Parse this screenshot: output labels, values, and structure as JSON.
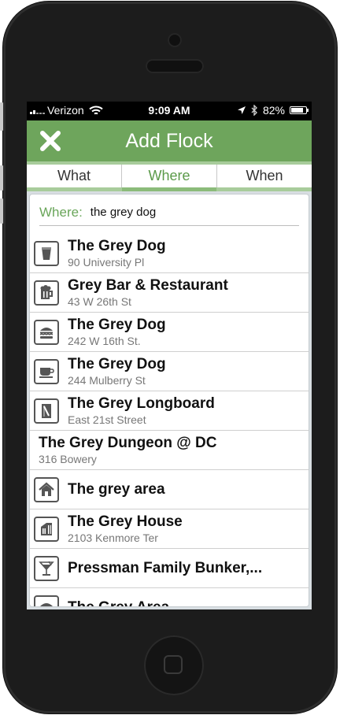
{
  "status_bar": {
    "carrier": "Verizon",
    "time": "9:09 AM",
    "battery": "82%"
  },
  "nav": {
    "title": "Add Flock",
    "close_icon": "close-x-icon"
  },
  "tabs": [
    {
      "label": "What",
      "active": false
    },
    {
      "label": "Where",
      "active": true
    },
    {
      "label": "When",
      "active": false
    }
  ],
  "search": {
    "label": "Where:",
    "value": "the grey dog"
  },
  "results": [
    {
      "name": "The Grey Dog",
      "address": "90 University Pl",
      "icon": "cup-icon"
    },
    {
      "name": "Grey Bar & Restaurant",
      "address": "43 W 26th St",
      "icon": "beer-mug-icon"
    },
    {
      "name": "The Grey Dog",
      "address": "242 W 16th St.",
      "icon": "burger-icon"
    },
    {
      "name": "The Grey Dog",
      "address": "244 Mulberry St",
      "icon": "coffee-cup-icon"
    },
    {
      "name": "The Grey Longboard",
      "address": "East 21st Street",
      "icon": "longboard-icon"
    },
    {
      "name": "The Grey Dungeon @ DC",
      "address": "316 Bowery",
      "icon": ""
    },
    {
      "name": "The grey area",
      "address": "",
      "icon": "home-icon"
    },
    {
      "name": "The Grey House",
      "address": "2103 Kenmore Ter",
      "icon": "building-icon"
    },
    {
      "name": "Pressman Family Bunker,...",
      "address": "",
      "icon": "cocktail-icon"
    },
    {
      "name": "The Grey Area",
      "address": "",
      "icon": "burger-icon"
    }
  ],
  "colors": {
    "accent": "#6ea55c",
    "tab_strip": "#a8cc9b",
    "active_tab_text": "#5b9a49"
  }
}
